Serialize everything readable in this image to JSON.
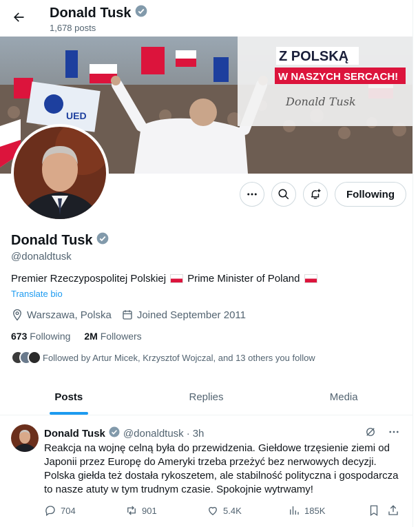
{
  "header": {
    "name": "Donald Tusk",
    "posts_count": "1,678 posts"
  },
  "banner": {
    "line1": "Z POLSKĄ",
    "line2": "W NASZYCH SERCACH!",
    "signature": "Donald Tusk",
    "flag_label": "UED"
  },
  "actions": {
    "follow_label": "Following"
  },
  "profile": {
    "name": "Donald Tusk",
    "handle": "@donaldtusk",
    "bio_part1": "Premier Rzeczypospolitej Polskiej",
    "bio_part2": "Prime Minister of Poland",
    "translate_label": "Translate bio",
    "location": "Warszawa, Polska",
    "joined": "Joined September 2011",
    "following_count": "673",
    "following_label": "Following",
    "followers_count": "2M",
    "followers_label": "Followers",
    "followed_by": "Followed by Artur Micek, Krzysztof Wojczal, and 13 others you follow"
  },
  "tabs": [
    {
      "label": "Posts"
    },
    {
      "label": "Replies"
    },
    {
      "label": "Media"
    }
  ],
  "tweet": {
    "name": "Donald Tusk",
    "handle": "@donaldtusk",
    "separator": "·",
    "time": "3h",
    "text": "Reakcja na wojnę celną była do przewidzenia. Giełdowe trzęsienie ziemi od Japonii przez Europę do Ameryki trzeba przeżyć bez nerwowych decyzji. Polska giełda też dostała rykoszetem, ale stabilność polityczna i gospodarcza to nasze atuty w tym trudnym czasie. Spokojnie wytrwamy!",
    "replies": "704",
    "reposts": "901",
    "likes": "5.4K",
    "views": "185K"
  },
  "colors": {
    "accent": "#1d9bf0",
    "verified": "#829aab",
    "text": "#0f1419",
    "muted": "#536471",
    "flag_red": "#dc143c"
  }
}
